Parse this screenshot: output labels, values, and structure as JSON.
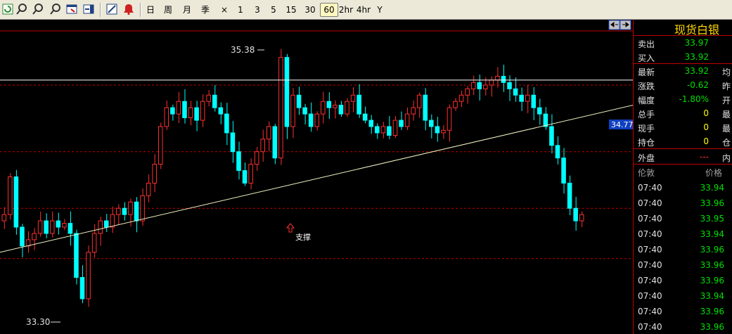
{
  "toolbar": {
    "periods": [
      {
        "label": "日",
        "active": false
      },
      {
        "label": "周",
        "active": false
      },
      {
        "label": "月",
        "active": false
      },
      {
        "label": "季",
        "active": false
      },
      {
        "label": "×",
        "active": false
      },
      {
        "label": "1",
        "active": false
      },
      {
        "label": "3",
        "active": false
      },
      {
        "label": "5",
        "active": false
      },
      {
        "label": "15",
        "active": false
      },
      {
        "label": "30",
        "active": false
      },
      {
        "label": "60",
        "active": true
      },
      {
        "label": "2hr",
        "active": false
      },
      {
        "label": "4hr",
        "active": false
      },
      {
        "label": "Y",
        "active": false
      }
    ]
  },
  "chart": {
    "high_label": "35.38",
    "low_label": "33.30",
    "current_price_tag": "34.77",
    "annotation": "支撑",
    "colors": {
      "up": "#ff3030",
      "down": "#00ffff",
      "trendline": "#f0f0c0",
      "hline": "#ffffff",
      "grid": "#c00000"
    }
  },
  "chart_data": {
    "type": "candlestick",
    "ylim": [
      33.1,
      35.6
    ],
    "high": 35.38,
    "low": 33.3,
    "current": 34.77,
    "resistance_level": 35.12,
    "grid_levels": [
      35.08,
      34.55,
      34.1,
      33.7
    ],
    "trendline": {
      "start": [
        0,
        33.75
      ],
      "end": [
        900,
        34.92
      ]
    },
    "closes": [
      34.05,
      34.35,
      33.95,
      33.8,
      33.85,
      33.9,
      34.0,
      33.9,
      34.0,
      33.95,
      33.98,
      33.9,
      33.55,
      33.38,
      33.75,
      33.9,
      34.0,
      33.95,
      34.05,
      34.1,
      34.05,
      34.15,
      34.0,
      34.2,
      34.3,
      34.45,
      34.75,
      34.9,
      34.85,
      34.95,
      34.82,
      34.9,
      34.8,
      34.95,
      35.0,
      34.9,
      34.85,
      34.7,
      34.55,
      34.4,
      34.3,
      34.45,
      34.55,
      34.65,
      34.75,
      34.5,
      35.3,
      34.75,
      35.0,
      34.9,
      34.85,
      34.75,
      34.85,
      34.95,
      34.9,
      34.92,
      34.85,
      34.95,
      35.0,
      34.85,
      34.8,
      34.75,
      34.7,
      34.75,
      34.68,
      34.8,
      34.75,
      34.85,
      34.9,
      35.0,
      34.8,
      34.75,
      34.7,
      34.72,
      34.9,
      34.95,
      35.0,
      35.05,
      35.1,
      35.05,
      35.08,
      35.12,
      35.15,
      35.1,
      35.05,
      35.0,
      34.95,
      35.0,
      34.9,
      34.85,
      34.75,
      34.6,
      34.5,
      34.3,
      34.1,
      34.0,
      34.05
    ],
    "price_ticks": [],
    "x_labels": []
  },
  "quote": {
    "title": "现货白银",
    "rows": [
      {
        "label": "卖出",
        "value": "33.97",
        "color": "green",
        "extra": ""
      },
      {
        "label": "买入",
        "value": "33.92",
        "color": "green",
        "extra": ""
      },
      {
        "label": "最新",
        "value": "33.92",
        "color": "green",
        "extra": "均"
      },
      {
        "label": "涨跌",
        "value": "-0.62",
        "color": "green",
        "extra": "昨"
      },
      {
        "label": "幅度",
        "value": "-1.80%",
        "color": "green",
        "extra": "开"
      },
      {
        "label": "总手",
        "value": "0",
        "color": "yellow",
        "extra": "最"
      },
      {
        "label": "现手",
        "value": "0",
        "color": "yellow",
        "extra": "最"
      },
      {
        "label": "持仓",
        "value": "0",
        "color": "yellow",
        "extra": "仓"
      },
      {
        "label": "外盘",
        "value": "---",
        "color": "red",
        "extra": "内"
      }
    ],
    "ticks_header": {
      "col1": "伦敦",
      "col2": "价格"
    },
    "ticks": [
      {
        "time": "07:40",
        "price": "33.94"
      },
      {
        "time": "07:40",
        "price": "33.96"
      },
      {
        "time": "07:40",
        "price": "33.95"
      },
      {
        "time": "07:40",
        "price": "33.94"
      },
      {
        "time": "07:40",
        "price": "33.96"
      },
      {
        "time": "07:40",
        "price": "33.96"
      },
      {
        "time": "07:40",
        "price": "33.96"
      },
      {
        "time": "07:40",
        "price": "33.94"
      },
      {
        "time": "07:40",
        "price": "33.96"
      },
      {
        "time": "07:40",
        "price": "33.96"
      }
    ]
  }
}
